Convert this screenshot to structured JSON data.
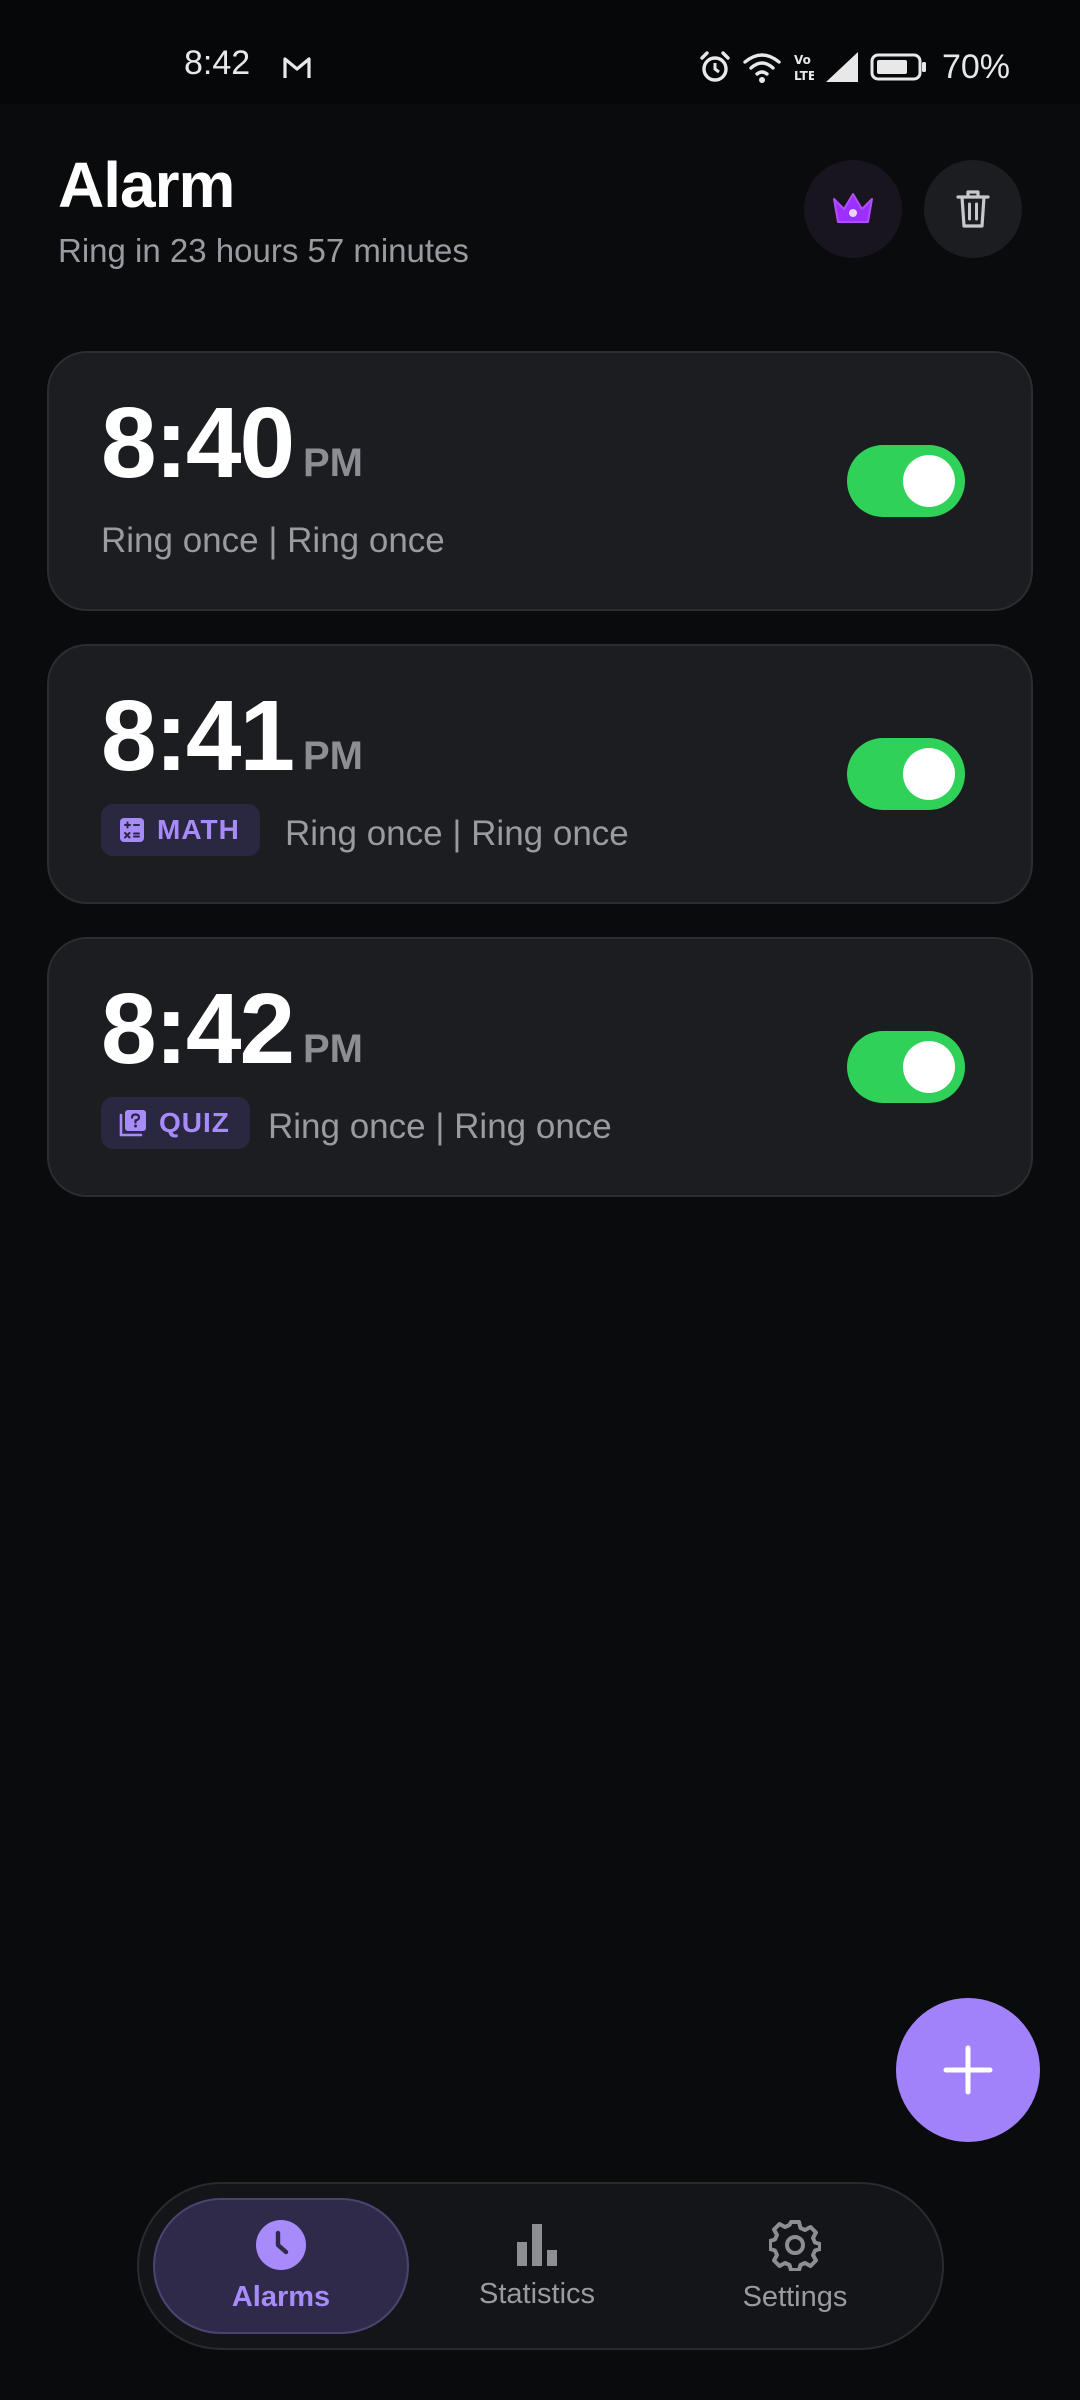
{
  "status_bar": {
    "time": "8:42",
    "battery": "70%",
    "volte": "Vo LTE"
  },
  "header": {
    "title": "Alarm",
    "subtitle": "Ring in 23 hours 57 minutes"
  },
  "alarms": [
    {
      "time": "8:40",
      "ampm": "PM",
      "mission": "",
      "repeat": "Ring once | Ring once",
      "enabled": true
    },
    {
      "time": "8:41",
      "ampm": "PM",
      "mission": "MATH",
      "repeat": "Ring once | Ring once",
      "enabled": true
    },
    {
      "time": "8:42",
      "ampm": "PM",
      "mission": "QUIZ",
      "repeat": "Ring once | Ring once",
      "enabled": true
    }
  ],
  "nav": {
    "items": [
      {
        "label": "Alarms",
        "icon": "clock-icon",
        "active": true
      },
      {
        "label": "Statistics",
        "icon": "bar-chart-icon",
        "active": false
      },
      {
        "label": "Settings",
        "icon": "gear-icon",
        "active": false
      }
    ]
  },
  "colors": {
    "accent": "#a78bfa",
    "fab": "#a282fb",
    "toggle_on": "#30d158",
    "card": "#1c1d20",
    "background": "#0a0b0d"
  }
}
